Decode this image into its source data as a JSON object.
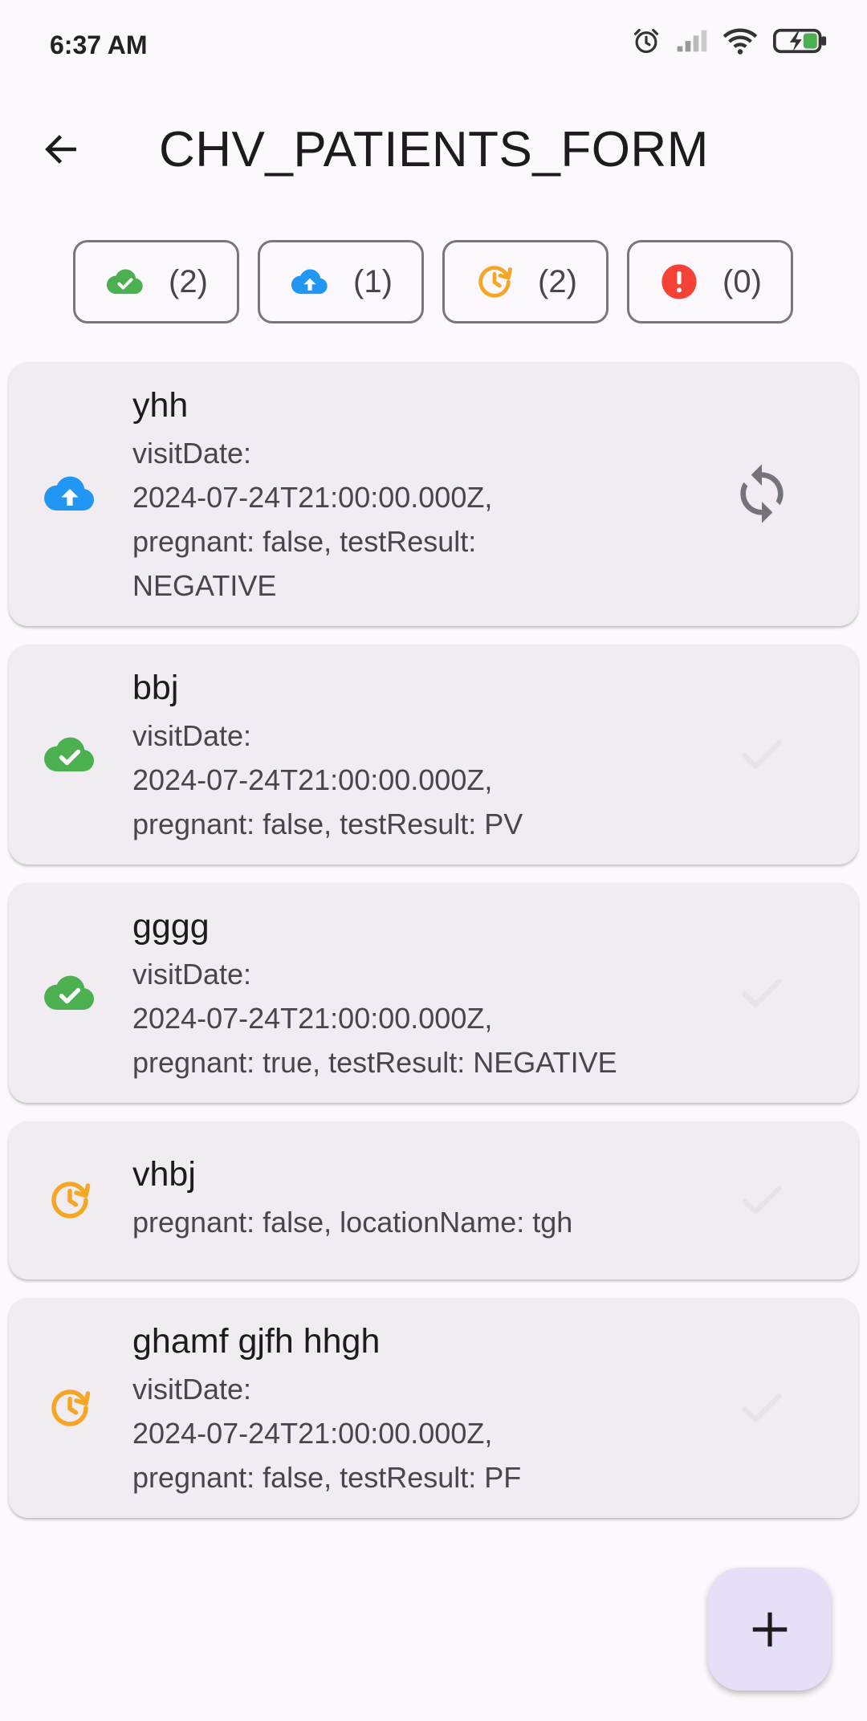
{
  "status_bar": {
    "time": "6:37 AM"
  },
  "app_bar": {
    "title": "CHV_PATIENTS_FORM"
  },
  "filters": [
    {
      "icon": "cloud-done-icon",
      "count": "(2)",
      "color": "#4caf50"
    },
    {
      "icon": "cloud-upload-icon",
      "count": "(1)",
      "color": "#2196f3"
    },
    {
      "icon": "pending-sync-icon",
      "count": "(2)",
      "color": "#f5a623"
    },
    {
      "icon": "error-icon",
      "count": "(0)",
      "color": "#f44336"
    }
  ],
  "records": [
    {
      "title": "yhh",
      "subtitle": "visitDate:\n2024-07-24T21:00:00.000Z,\npregnant: false, testResult:\nNEGATIVE",
      "status_icon": "cloud-upload-icon",
      "action_icon": "sync-icon"
    },
    {
      "title": "bbj",
      "subtitle": "visitDate:\n2024-07-24T21:00:00.000Z,\npregnant: false, testResult: PV",
      "status_icon": "cloud-done-icon",
      "action_icon": "check-icon"
    },
    {
      "title": "gggg",
      "subtitle": "visitDate:\n2024-07-24T21:00:00.000Z,\npregnant: true, testResult: NEGATIVE",
      "status_icon": "cloud-done-icon",
      "action_icon": "check-icon"
    },
    {
      "title": "vhbj",
      "subtitle": "pregnant: false, locationName: tgh",
      "status_icon": "pending-sync-icon",
      "action_icon": "check-icon"
    },
    {
      "title": "ghamf gjfh hhgh",
      "subtitle": "visitDate:\n2024-07-24T21:00:00.000Z,\npregnant: false, testResult: PF",
      "status_icon": "pending-sync-icon",
      "action_icon": "check-icon"
    }
  ],
  "colors": {
    "synced": "#4caf50",
    "uploading": "#2196f3",
    "pending": "#f5a623",
    "error": "#f44336",
    "fab_bg": "#e6dff8"
  },
  "fab": {
    "icon": "add-icon"
  }
}
